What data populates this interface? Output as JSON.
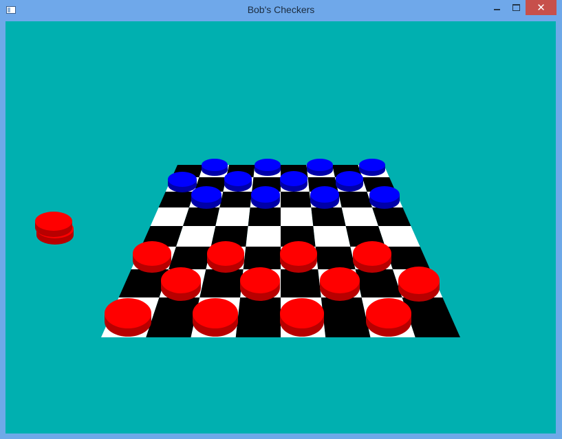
{
  "window": {
    "title": "Bob's Checkers",
    "icon": "app-window-icon",
    "controls": {
      "minimize_icon": "minimize-icon",
      "maximize_icon": "maximize-icon",
      "close_glyph": "✕"
    }
  },
  "scene": {
    "background_color": "#00b0b0",
    "board": {
      "rows": 8,
      "cols": 8,
      "dark_square_color": "#000000",
      "light_square_color": "#ffffff"
    },
    "pieces": {
      "red_color": "#ff0000",
      "blue_color": "#0000ff",
      "blue_count": 12,
      "red_count": 12,
      "captured_red_count": 2
    }
  }
}
